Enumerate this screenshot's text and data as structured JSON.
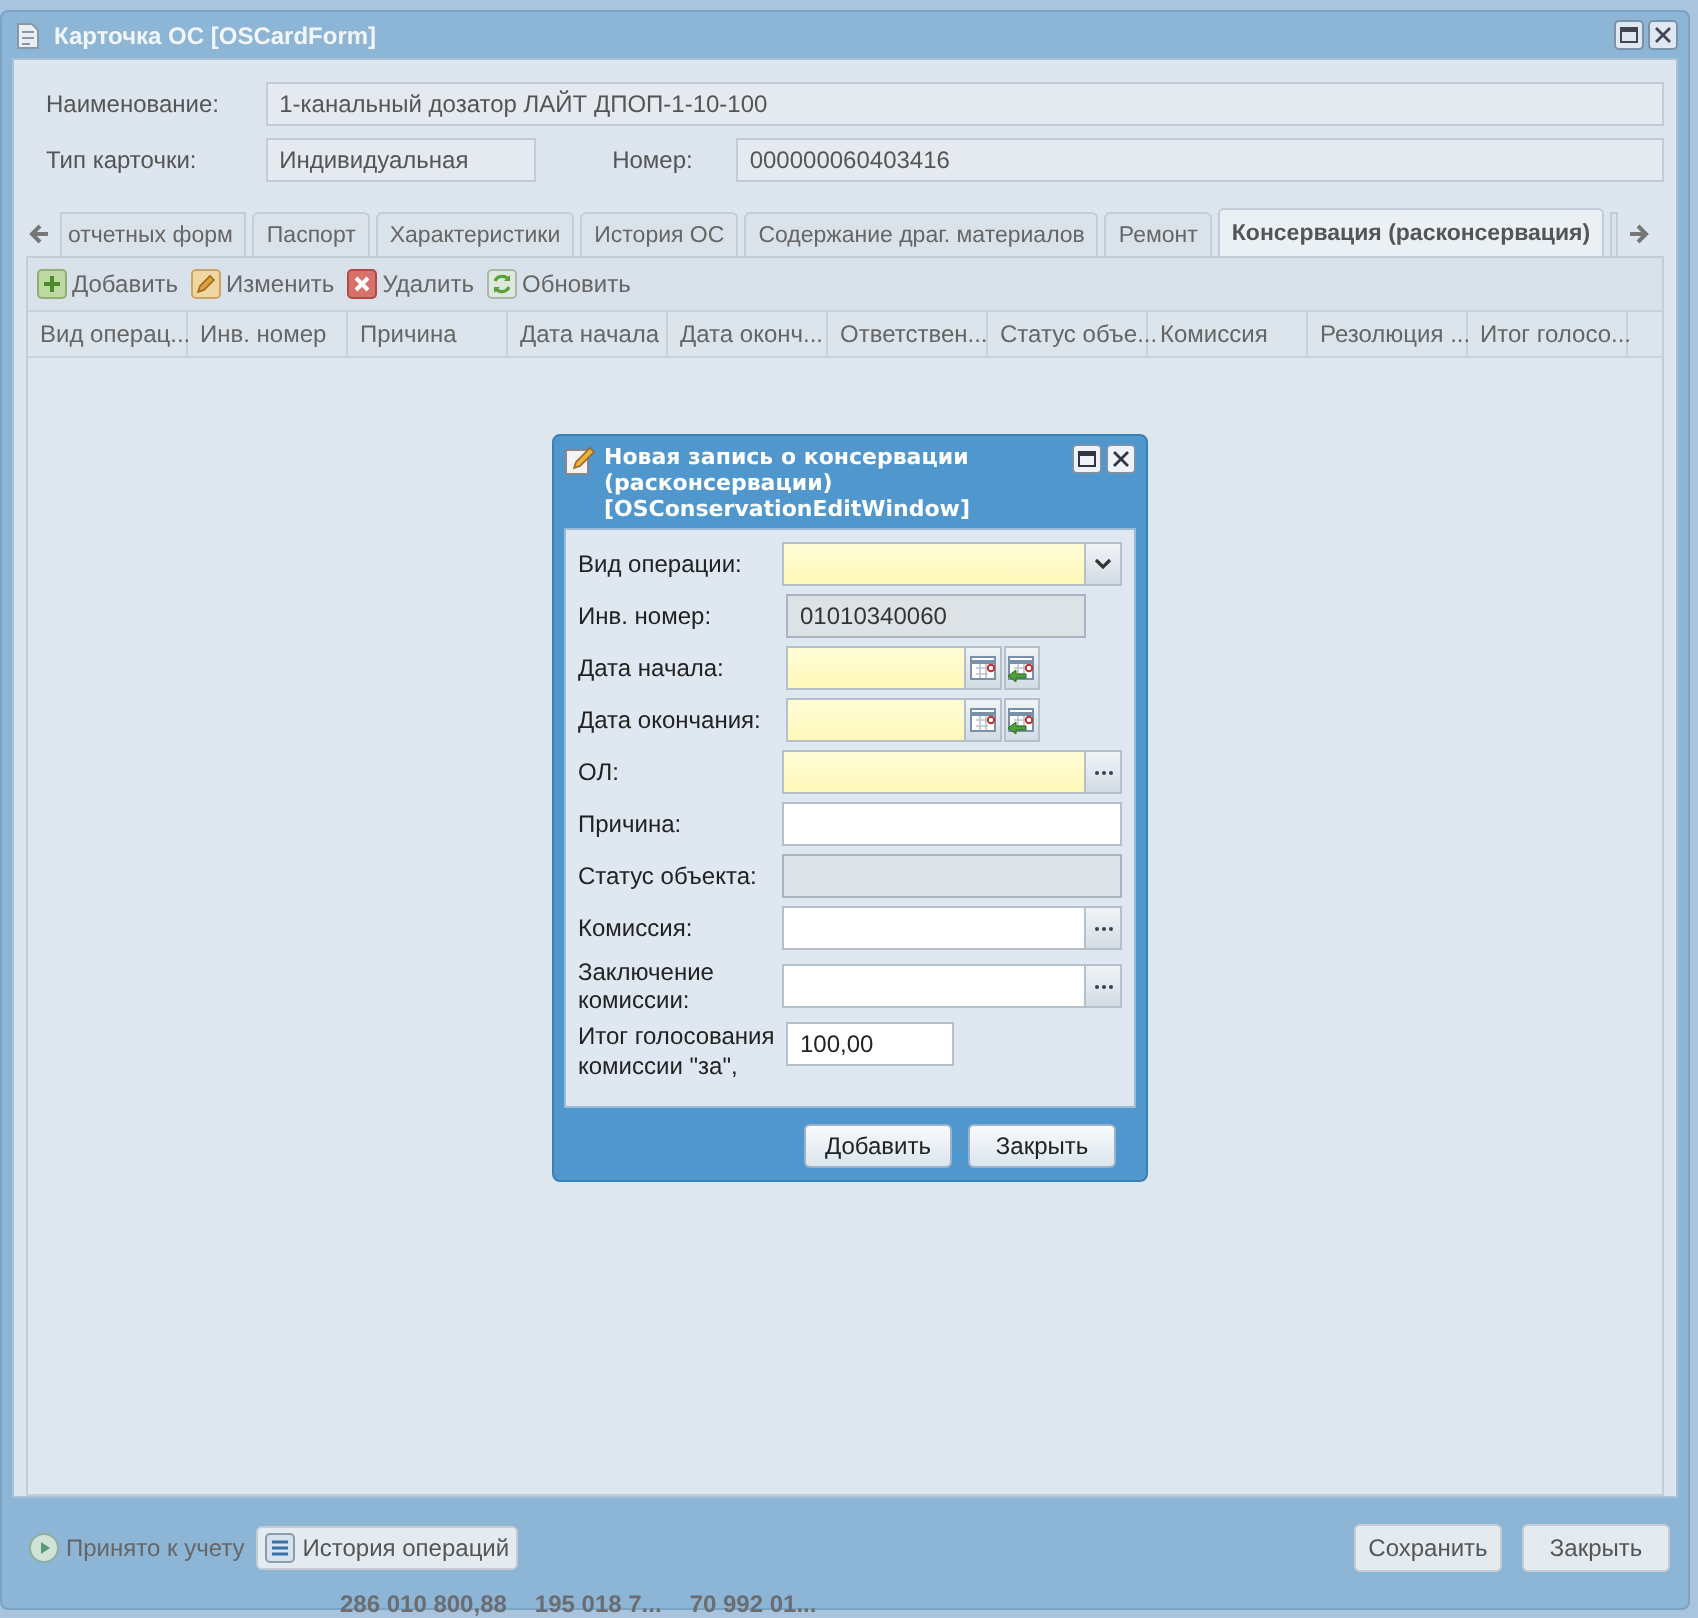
{
  "window": {
    "title": "Карточка ОС [OSCardForm]"
  },
  "header_fields": [
    {
      "label": "Наименование:",
      "value": "1-канальный дозатор ЛАЙТ ДПОП-1-10-100"
    },
    {
      "label": "Тип карточки:",
      "value": "Индивидуальная"
    },
    {
      "label": "Номер:",
      "value": "000000060403416"
    }
  ],
  "tabs": [
    {
      "label": "отчетных форм",
      "selected": false
    },
    {
      "label": "Паспорт",
      "selected": false
    },
    {
      "label": "Характеристики",
      "selected": false
    },
    {
      "label": "История ОС",
      "selected": false
    },
    {
      "label": "Содержание драг. материалов",
      "selected": false
    },
    {
      "label": "Ремонт",
      "selected": false
    },
    {
      "label": "Консервация (расконсервация)",
      "selected": true
    }
  ],
  "toolbar": [
    {
      "kind": "add",
      "label": "Добавить"
    },
    {
      "kind": "edit",
      "label": "Изменить"
    },
    {
      "kind": "delete",
      "label": "Удалить"
    },
    {
      "kind": "refresh",
      "label": "Обновить"
    }
  ],
  "table": {
    "columns": [
      "Вид операц...",
      "Инв. номер",
      "Причина",
      "Дата начала",
      "Дата оконч...",
      "Ответствен...",
      "Статус объе...",
      "Комиссия",
      "Резолюция ...",
      "Итог голосо..."
    ]
  },
  "footer": {
    "status": "Принято к учету",
    "history_button": "История операций",
    "buttons": [
      "Сохранить",
      "Закрыть"
    ]
  },
  "background_totals": [
    "286 010 800,88",
    "195 018 7...",
    "70 992 01..."
  ],
  "dialog": {
    "title": "Новая запись о консервации (расконсервации) [OSConservationEditWindow]",
    "fields": [
      {
        "label": "Вид операции:",
        "kind": "combo",
        "required": true,
        "disabled": false
      },
      {
        "label": "Инв. номер:",
        "kind": "short",
        "value": "01010340060",
        "required": false,
        "disabled": true
      },
      {
        "label": "Дата начала:",
        "kind": "date",
        "required": true,
        "disabled": false
      },
      {
        "label": "Дата окончания:",
        "kind": "date",
        "required": true,
        "disabled": false
      },
      {
        "label": "ОЛ:",
        "kind": "picker",
        "required": true,
        "disabled": false
      },
      {
        "label": "Причина:",
        "kind": "text",
        "required": false,
        "disabled": false
      },
      {
        "label": "Статус объекта:",
        "kind": "text",
        "required": false,
        "disabled": true
      },
      {
        "label": "Комиссия:",
        "kind": "picker",
        "required": false,
        "disabled": false
      },
      {
        "label": "Заключение комиссии:",
        "kind": "picker",
        "required": false,
        "disabled": false
      },
      {
        "label": "Итог голосования комиссии \"за\",",
        "kind": "short",
        "value": "100,00",
        "required": false,
        "disabled": false
      }
    ],
    "buttons": [
      "Добавить",
      "Закрыть"
    ]
  }
}
